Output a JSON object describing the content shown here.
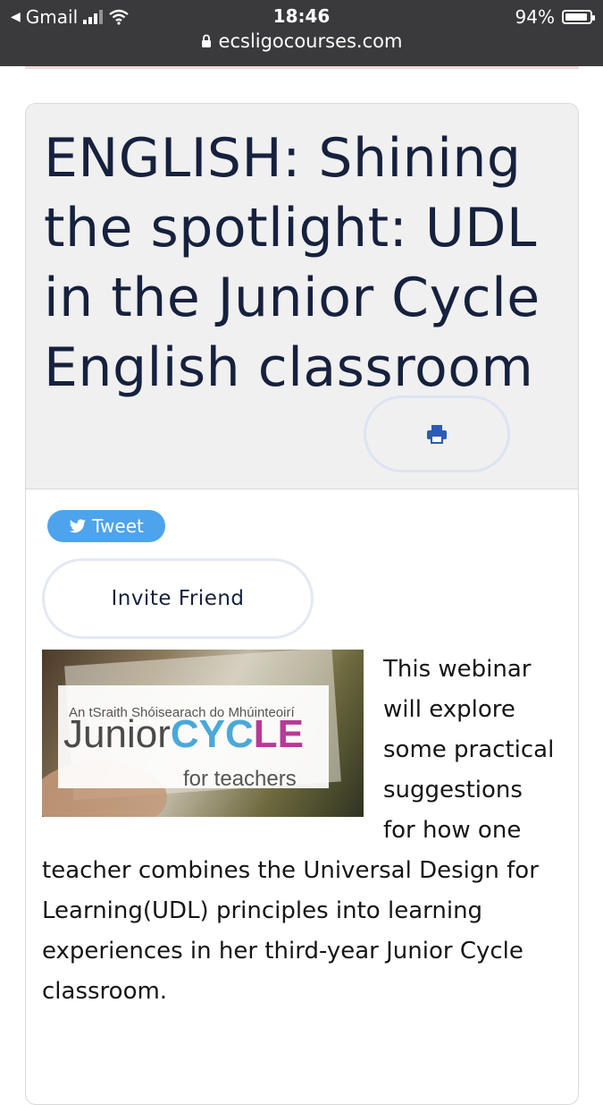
{
  "status_bar": {
    "back_app": "Gmail",
    "time": "18:46",
    "battery_percent": "94%",
    "battery_level": 0.94,
    "url": "ecsligocourses.com"
  },
  "course": {
    "title": "ENGLISH: Shining the spotlight: UDL in the Junior Cycle English classroom",
    "tweet_label": "Tweet",
    "invite_label": "Invite Friend",
    "image": {
      "irish_text": "An tSraith Shóisearach do Mhúinteoirí",
      "logo_junior": "Junior",
      "logo_cyc": "CYC",
      "logo_le": "LE",
      "logo_sub": "for teachers"
    },
    "description": "This webinar will explore some practical suggestions for how one teacher combines the Universal Design for Learning(UDL) principles into learning experiences in her third-year Junior Cycle classroom."
  },
  "colors": {
    "title": "#16213e",
    "tweet": "#4da3ec",
    "print_icon": "#2b5bb5",
    "status_bar_bg": "#3a3a3c"
  },
  "icons": {
    "back": "back-arrow-icon",
    "signal": "cellular-signal-icon",
    "wifi": "wifi-icon",
    "lock": "lock-icon",
    "battery": "battery-icon",
    "print": "print-icon",
    "twitter": "twitter-bird-icon"
  }
}
